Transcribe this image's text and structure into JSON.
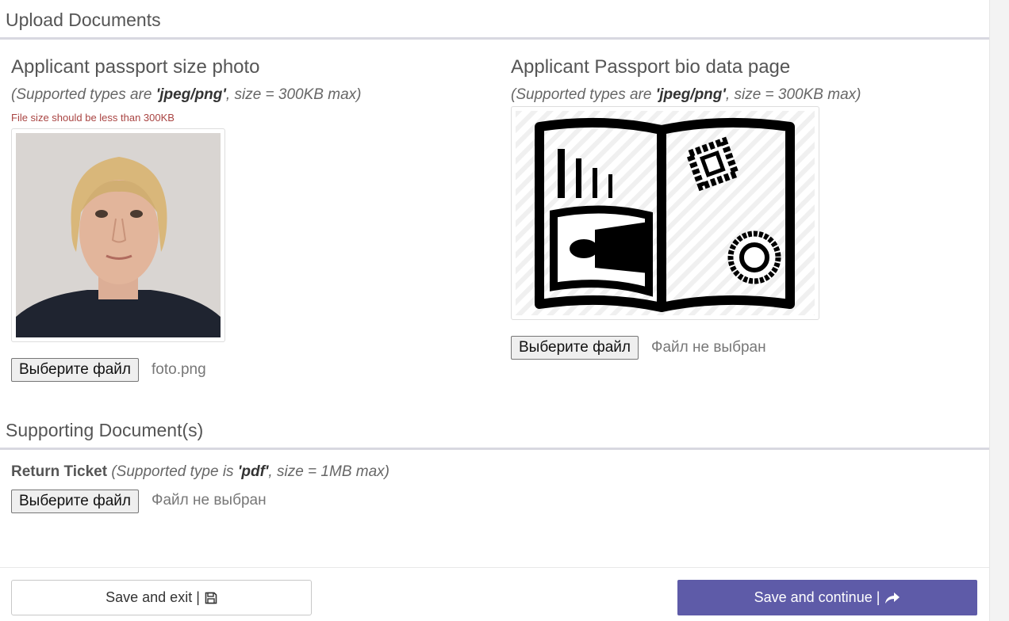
{
  "upload": {
    "title": "Upload Documents",
    "photo": {
      "title": "Applicant passport size photo",
      "hint_prefix": "(Supported types are ",
      "hint_types": "'jpeg/png'",
      "hint_suffix": ", size = 300KB max)",
      "error": "File size should be less than 300KB",
      "file_button": "Выберите файл",
      "file_name": "foto.png"
    },
    "bio": {
      "title": "Applicant Passport bio data page",
      "hint_prefix": "(Supported types are ",
      "hint_types": "'jpeg/png'",
      "hint_suffix": ", size = 300KB max)",
      "file_button": "Выберите файл",
      "file_name": "Файл не выбран"
    }
  },
  "supporting": {
    "title": "Supporting Document(s)",
    "ticket": {
      "label": "Return Ticket",
      "hint_prefix": " (Supported type is ",
      "hint_types": "'pdf'",
      "hint_suffix": ", size = 1MB max)",
      "file_button": "Выберите файл",
      "file_name": "Файл не выбран"
    }
  },
  "actions": {
    "save_exit": "Save and exit |",
    "save_continue": "Save and continue |"
  },
  "icons": {
    "save_exit": "floppy-disk-icon",
    "save_continue": "share-arrow-icon",
    "passport_placeholder": "passport-book-icon"
  },
  "colors": {
    "primary": "#5e5ba8",
    "error": "#a94442"
  }
}
